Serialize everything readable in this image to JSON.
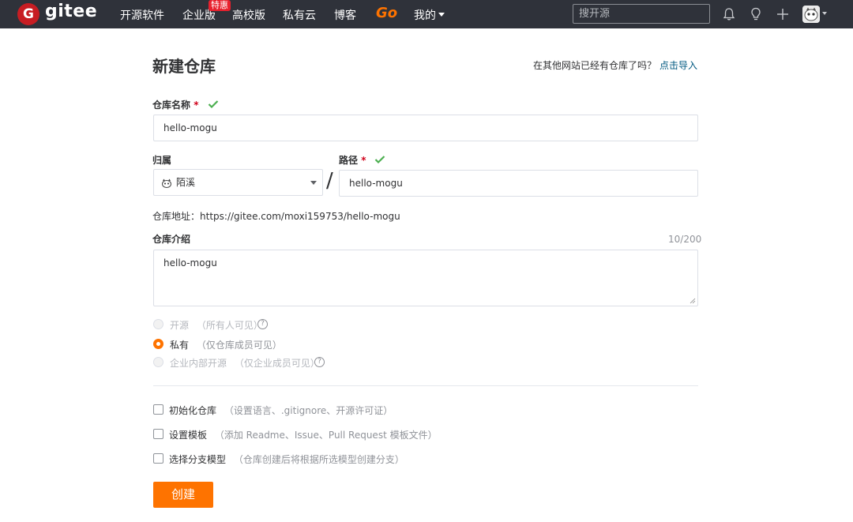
{
  "navbar": {
    "brand": "gitee",
    "logo_letter": "G",
    "items": [
      "开源软件",
      "企业版",
      "高校版",
      "私有云",
      "博客"
    ],
    "hot_badge": "特惠",
    "go_label": "Go",
    "mine_label": "我的",
    "search_placeholder": "搜开源",
    "icons": [
      "bell-icon",
      "lightbulb-icon",
      "plus-icon",
      "user-avatar"
    ],
    "colors": {
      "bar": "#2f323a",
      "logo": "#c71d23",
      "go": "#fe7300",
      "badge": "#e8202d"
    }
  },
  "form": {
    "title": "新建仓库",
    "import_question": "在其他网站已经有仓库了吗？",
    "import_link": "点击导入",
    "repo_name_label": "仓库名称",
    "required_mark": "*",
    "repo_name_value": "hello-mogu",
    "owner_label": "归属",
    "owner_value": "陌溪",
    "path_label": "路径",
    "path_separator": "/",
    "path_value": "hello-mogu",
    "address_label": "仓库地址：",
    "address_value": "https://gitee.com/moxi159753/hello-mogu",
    "intro_label": "仓库介绍",
    "intro_counter": "10/200",
    "intro_value": "hello-mogu",
    "visibility": [
      {
        "label": "开源",
        "hint": "（所有人可见）",
        "selected": false,
        "disabled": true,
        "help": true
      },
      {
        "label": "私有",
        "hint": "（仅仓库成员可见）",
        "selected": true,
        "disabled": false,
        "help": false
      },
      {
        "label": "企业内部开源",
        "hint": "（仅企业成员可见）",
        "selected": false,
        "disabled": true,
        "help": true
      }
    ],
    "options": [
      {
        "label": "初始化仓库",
        "hint": "（设置语言、.gitignore、开源许可证）",
        "checked": false
      },
      {
        "label": "设置模板",
        "hint": "（添加 Readme、Issue、Pull Request 模板文件）",
        "checked": false
      },
      {
        "label": "选择分支模型",
        "hint": "（仓库创建后将根据所选模型创建分支）",
        "checked": false
      }
    ],
    "submit_label": "创建",
    "colors": {
      "accent": "#fe7300",
      "valid": "#4caf50",
      "link": "#005980",
      "required": "#d0021b"
    }
  }
}
